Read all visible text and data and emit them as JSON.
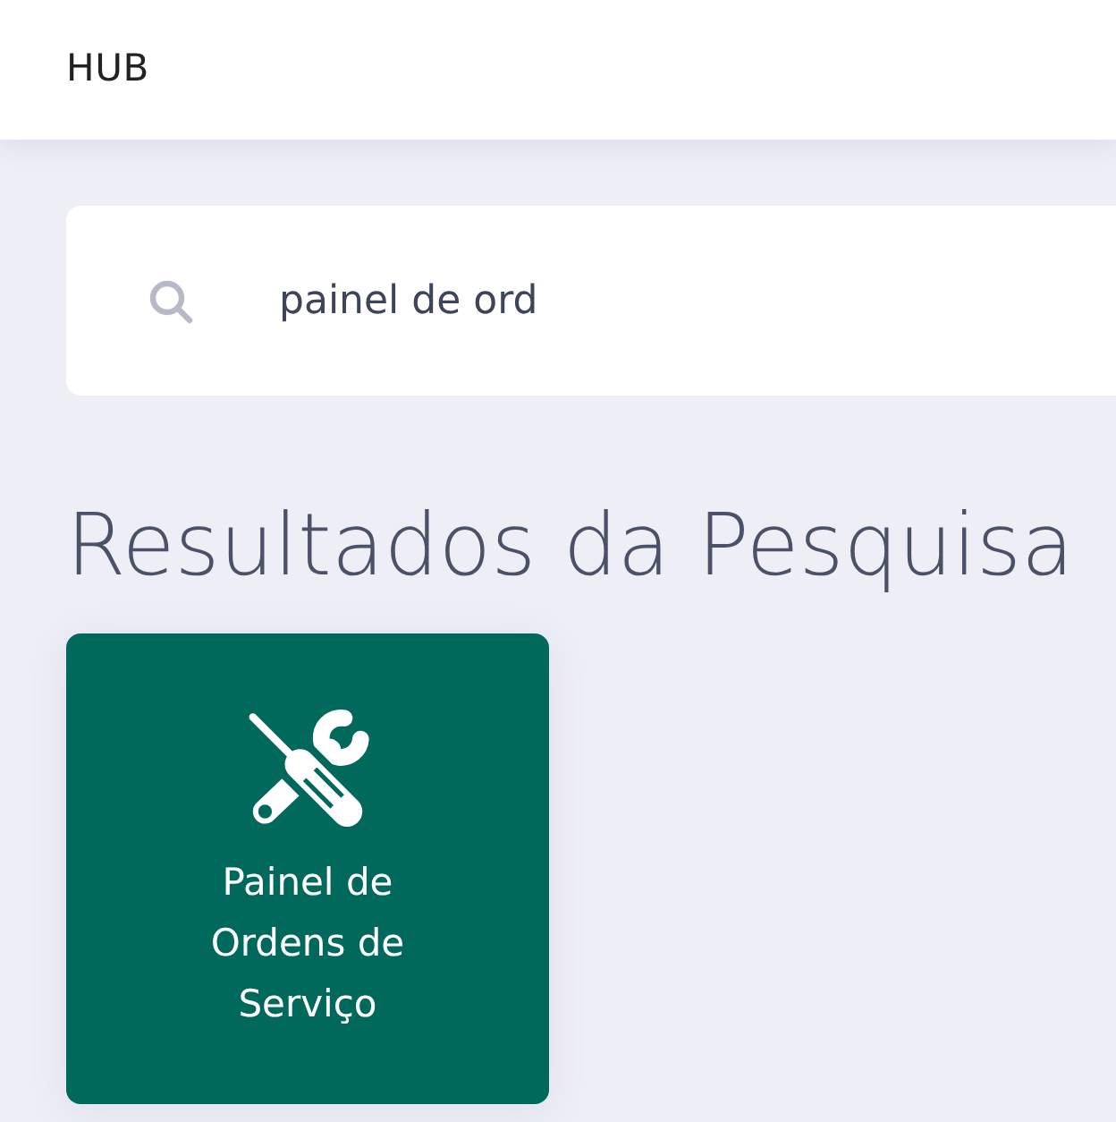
{
  "header": {
    "title": "HUB"
  },
  "search": {
    "value": "painel de ord"
  },
  "results": {
    "title": "Resultados da Pesquisa",
    "items": [
      {
        "label": "Painel de Ordens de Serviço"
      }
    ]
  }
}
